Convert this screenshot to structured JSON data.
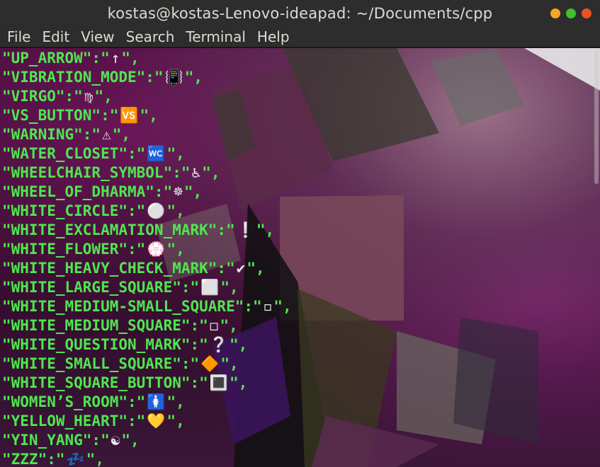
{
  "window": {
    "title": "kostas@kostas-Lenovo-ideapad: ~/Documents/cpp",
    "controls": [
      {
        "name": "minimize",
        "color": "#f5a623"
      },
      {
        "name": "maximize",
        "color": "#3ec12f"
      },
      {
        "name": "close",
        "color": "#e95420"
      }
    ]
  },
  "menu": [
    "File",
    "Edit",
    "View",
    "Search",
    "Terminal",
    "Help"
  ],
  "terminal": {
    "text_color": "#4ee74e",
    "lines": [
      {
        "key": "\"UP_ARROW\":\"",
        "glyph": "↑",
        "end": "\","
      },
      {
        "key": "\"VIBRATION_MODE\":\"",
        "glyph": "📳",
        "end": "\","
      },
      {
        "key": "\"VIRGO\":\"",
        "glyph": "♍",
        "end": "\","
      },
      {
        "key": "\"VS_BUTTON\":\"",
        "glyph": "🆚",
        "end": "\","
      },
      {
        "key": "\"WARNING\":\"",
        "glyph": "⚠",
        "end": "\","
      },
      {
        "key": "\"WATER_CLOSET\":\"",
        "glyph": "🚾",
        "end": "\","
      },
      {
        "key": "\"WHEELCHAIR_SYMBOL\":\"",
        "glyph": "♿",
        "end": "\","
      },
      {
        "key": "\"WHEEL_OF_DHARMA\":\"",
        "glyph": "☸",
        "end": "\","
      },
      {
        "key": "\"WHITE_CIRCLE\":\"",
        "glyph": "⚪",
        "end": "\","
      },
      {
        "key": "\"WHITE_EXCLAMATION_MARK\":\"",
        "glyph": "❕",
        "end": "\","
      },
      {
        "key": "\"WHITE_FLOWER\":\"",
        "glyph": "💮",
        "end": "\","
      },
      {
        "key": "\"WHITE_HEAVY_CHECK_MARK\":\"",
        "glyph": "✔",
        "end": "\","
      },
      {
        "key": "\"WHITE_LARGE_SQUARE\":\"",
        "glyph": "⬜",
        "end": "\","
      },
      {
        "key": "\"WHITE_MEDIUM-SMALL_SQUARE\":\"",
        "glyph": "◽",
        "end": "\","
      },
      {
        "key": "\"WHITE_MEDIUM_SQUARE\":\"",
        "glyph": "◻",
        "end": "\","
      },
      {
        "key": "\"WHITE_QUESTION_MARK\":\"",
        "glyph": "❔",
        "end": "\","
      },
      {
        "key": "\"WHITE_SMALL_SQUARE\":\"",
        "glyph": "🔶",
        "end": "\","
      },
      {
        "key": "\"WHITE_SQUARE_BUTTON\":\"",
        "glyph": "🔳",
        "end": "\","
      },
      {
        "key": "\"WOMEN’S_ROOM\":\"",
        "glyph": "🚺",
        "end": "\","
      },
      {
        "key": "\"YELLOW_HEART\":\"",
        "glyph": "💛",
        "end": "\","
      },
      {
        "key": "\"YIN_YANG\":\"",
        "glyph": "☯",
        "end": "\","
      },
      {
        "key": "\"ZZZ\":\"",
        "glyph": "💤",
        "end": "\","
      }
    ]
  }
}
